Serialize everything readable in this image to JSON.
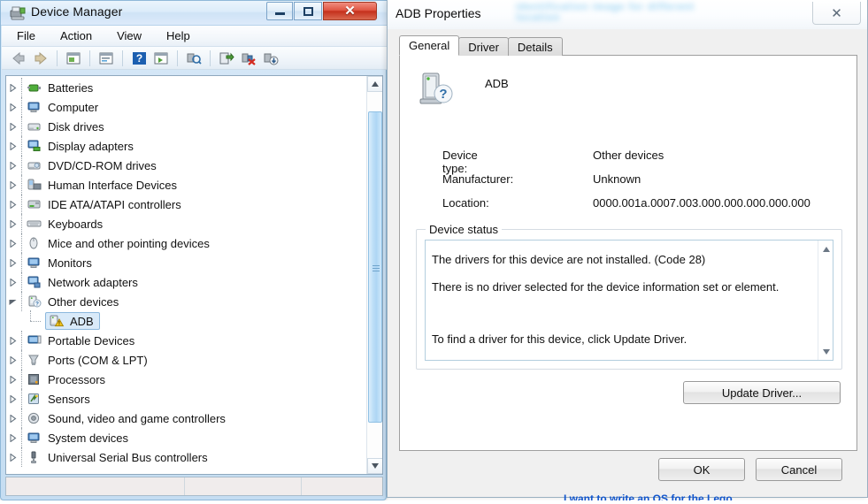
{
  "device_manager": {
    "title": "Device Manager",
    "title_icon": "device-manager-icon",
    "window_buttons": {
      "minimize": "–",
      "maximize": "□",
      "close": "✕"
    },
    "menu": [
      "File",
      "Action",
      "View",
      "Help"
    ],
    "toolbar": [
      "back-icon",
      "forward-icon",
      "separator",
      "properties-icon",
      "separator",
      "help-window-icon",
      "separator",
      "help-icon",
      "show-hidden-icon",
      "separator",
      "scan-hardware-icon",
      "separator",
      "update-driver-icon",
      "uninstall-device-icon",
      "install-legacy-icon"
    ],
    "tree": [
      {
        "label": "Batteries",
        "icon": "battery-icon",
        "level": 0,
        "expanded": false,
        "selected": false
      },
      {
        "label": "Computer",
        "icon": "computer-icon",
        "level": 0,
        "expanded": false,
        "selected": false
      },
      {
        "label": "Disk drives",
        "icon": "disk-drive-icon",
        "level": 0,
        "expanded": false,
        "selected": false
      },
      {
        "label": "Display adapters",
        "icon": "display-adapter-icon",
        "level": 0,
        "expanded": false,
        "selected": false
      },
      {
        "label": "DVD/CD-ROM drives",
        "icon": "dvd-drive-icon",
        "level": 0,
        "expanded": false,
        "selected": false
      },
      {
        "label": "Human Interface Devices",
        "icon": "hid-icon",
        "level": 0,
        "expanded": false,
        "selected": false
      },
      {
        "label": "IDE ATA/ATAPI controllers",
        "icon": "ide-controller-icon",
        "level": 0,
        "expanded": false,
        "selected": false
      },
      {
        "label": "Keyboards",
        "icon": "keyboard-icon",
        "level": 0,
        "expanded": false,
        "selected": false
      },
      {
        "label": "Mice and other pointing devices",
        "icon": "mouse-icon",
        "level": 0,
        "expanded": false,
        "selected": false
      },
      {
        "label": "Monitors",
        "icon": "monitor-icon",
        "level": 0,
        "expanded": false,
        "selected": false
      },
      {
        "label": "Network adapters",
        "icon": "network-adapter-icon",
        "level": 0,
        "expanded": false,
        "selected": false
      },
      {
        "label": "Other devices",
        "icon": "other-devices-icon",
        "level": 0,
        "expanded": true,
        "selected": false
      },
      {
        "label": "ADB",
        "icon": "unknown-device-warning-icon",
        "level": 1,
        "expanded": false,
        "selected": true
      },
      {
        "label": "Portable Devices",
        "icon": "portable-device-icon",
        "level": 0,
        "expanded": false,
        "selected": false
      },
      {
        "label": "Ports (COM & LPT)",
        "icon": "port-icon",
        "level": 0,
        "expanded": false,
        "selected": false
      },
      {
        "label": "Processors",
        "icon": "processor-icon",
        "level": 0,
        "expanded": false,
        "selected": false
      },
      {
        "label": "Sensors",
        "icon": "sensor-icon",
        "level": 0,
        "expanded": false,
        "selected": false
      },
      {
        "label": "Sound, video and game controllers",
        "icon": "sound-controller-icon",
        "level": 0,
        "expanded": false,
        "selected": false
      },
      {
        "label": "System devices",
        "icon": "system-device-icon",
        "level": 0,
        "expanded": false,
        "selected": false
      },
      {
        "label": "Universal Serial Bus controllers",
        "icon": "usb-controller-icon",
        "level": 0,
        "expanded": false,
        "selected": false
      }
    ],
    "scrollbar": {
      "up": "scroll-up-arrow",
      "down": "scroll-down-arrow"
    },
    "status_bar": [
      "",
      "",
      ""
    ]
  },
  "dialog": {
    "title": "ADB Properties",
    "watermark_line1": "identification image for different",
    "watermark_line2": "location",
    "close_label": "✕",
    "tabs": [
      {
        "label": "General",
        "active": true
      },
      {
        "label": "Driver",
        "active": false
      },
      {
        "label": "Details",
        "active": false
      }
    ],
    "device": {
      "name": "ADB",
      "icon": "unknown-device-icon",
      "fields": [
        {
          "label": "Device type:",
          "value": "Other devices"
        },
        {
          "label": "Manufacturer:",
          "value": "Unknown"
        },
        {
          "label": "Location:",
          "value": "0000.001a.0007.003.000.000.000.000.000"
        }
      ]
    },
    "device_status": {
      "legend": "Device status",
      "lines": [
        "The drivers for this device are not installed. (Code 28)",
        "There is no driver selected for the device information set or element.",
        "To find a driver for this device, click Update Driver."
      ],
      "scroll_up": "scroll-up-arrow",
      "scroll_down": "scroll-down-arrow"
    },
    "buttons": {
      "update_driver": "Update Driver...",
      "ok": "OK",
      "cancel": "Cancel"
    }
  },
  "background": {
    "link_text": "I want to write an OS for the Lego"
  },
  "colors": {
    "title_close_red": "#c5301c",
    "selection_blue": "#d9eaf9",
    "link_blue": "#1155cc",
    "scrollbar_blue": "#aed6f4"
  }
}
